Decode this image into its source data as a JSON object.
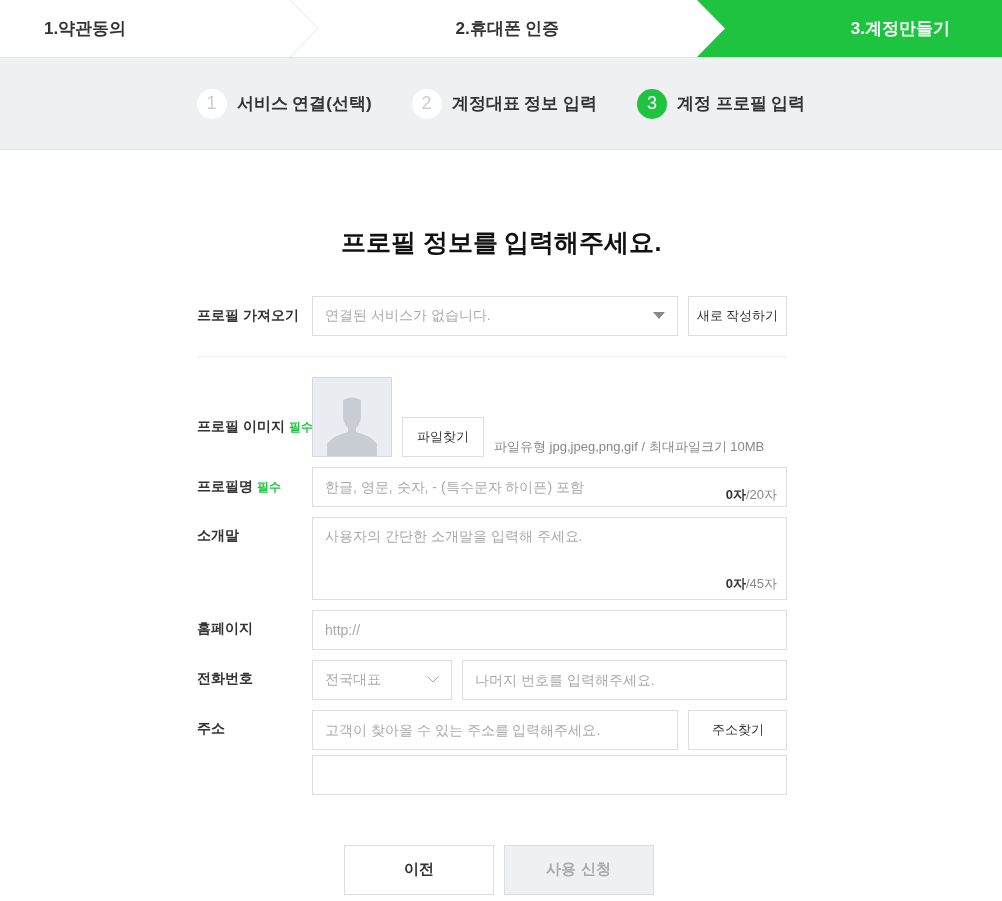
{
  "steps": [
    {
      "label": "1.약관동의",
      "selected": false
    },
    {
      "label": "2.휴대폰 인증",
      "selected": false
    },
    {
      "label": "3.계정만들기",
      "selected": true
    }
  ],
  "substeps": [
    {
      "number": "1",
      "label": "서비스 연결(선택)",
      "selected": false
    },
    {
      "number": "2",
      "label": "계정대표 정보 입력",
      "selected": false
    },
    {
      "number": "3",
      "label": "계정 프로필 입력",
      "selected": true
    }
  ],
  "title": "프로필 정보를 입력해주세요.",
  "profile_import": {
    "label": "프로필 가져오기",
    "select_value": "연결된 서비스가 없습니다.",
    "button": "새로 작성하기"
  },
  "profile_image": {
    "label": "프로필 이미지",
    "required": "필수",
    "button": "파일찾기",
    "hint": "파일유형 jpg,jpeg,png,gif / 최대파일크기 10MB"
  },
  "profile_name": {
    "label": "프로필명",
    "required": "필수",
    "placeholder": "한글, 영문, 숫자, - (특수문자 하이픈) 포함",
    "count": "0자",
    "limit": "/20자"
  },
  "intro": {
    "label": "소개말",
    "placeholder": "사용자의 간단한 소개말을 입력해 주세요.",
    "count": "0자",
    "limit": "/45자"
  },
  "homepage": {
    "label": "홈페이지",
    "placeholder": "http://"
  },
  "phone": {
    "label": "전화번호",
    "area_value": "전국대표",
    "placeholder": "나머지 번호를 입력해주세요."
  },
  "address": {
    "label": "주소",
    "placeholder": "고객이 찾아올 수 있는 주소를 입력해주세요.",
    "button": "주소찾기"
  },
  "buttons": [
    {
      "label": "이전",
      "disabled": false
    },
    {
      "label": "사용 신청",
      "disabled": true
    }
  ]
}
